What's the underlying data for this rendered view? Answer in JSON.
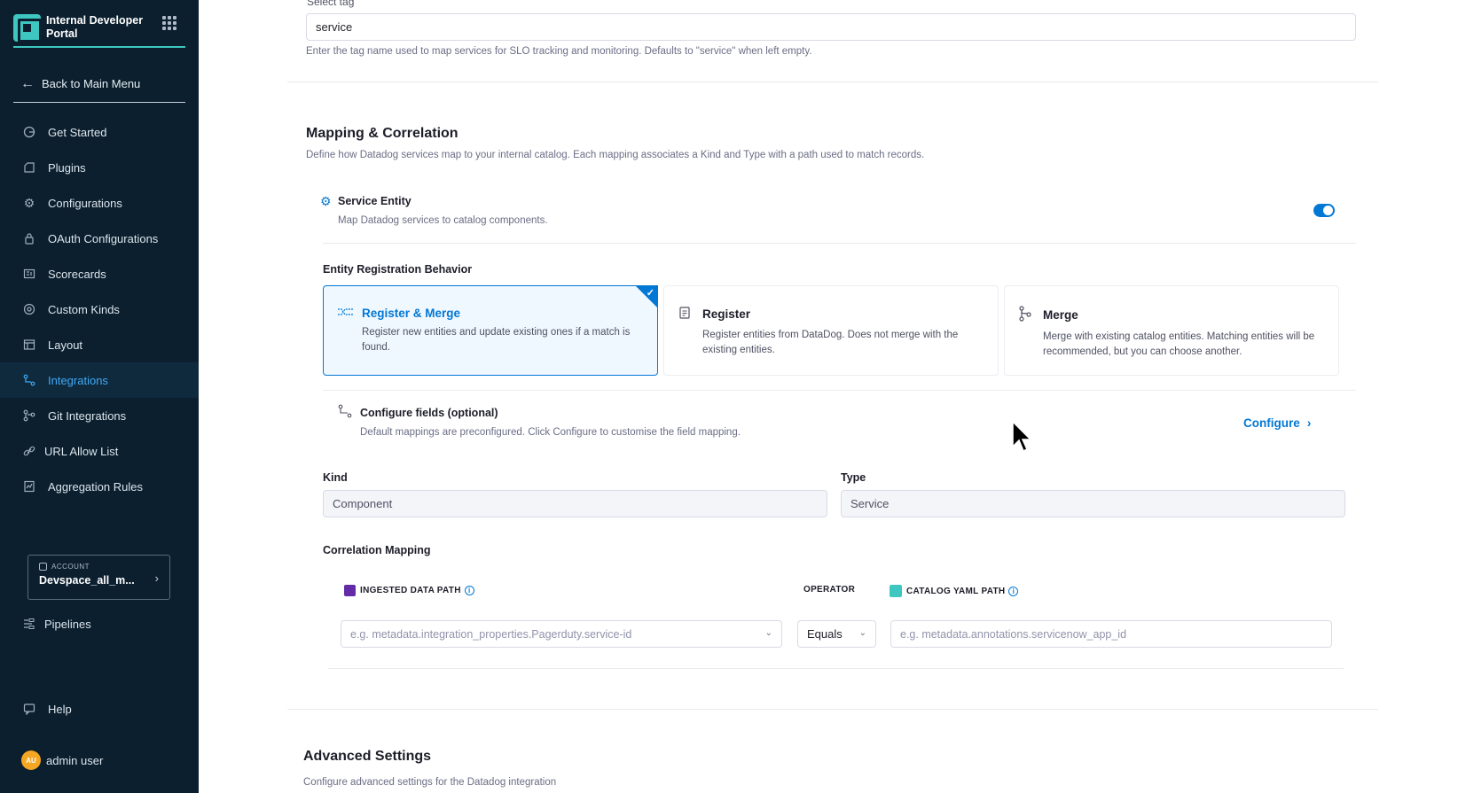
{
  "sidebar": {
    "brand_title": "Internal Developer Portal",
    "back_label": "Back to Main Menu",
    "items": [
      {
        "label": "Get Started",
        "icon": "play-icon"
      },
      {
        "label": "Plugins",
        "icon": "plug-icon"
      },
      {
        "label": "Configurations",
        "icon": "gear-icon"
      },
      {
        "label": "OAuth Configurations",
        "icon": "lock-icon"
      },
      {
        "label": "Scorecards",
        "icon": "scorecard-icon"
      },
      {
        "label": "Custom Kinds",
        "icon": "settings-icon"
      },
      {
        "label": "Layout",
        "icon": "layout-icon"
      },
      {
        "label": "Integrations",
        "icon": "integration-icon",
        "active": true
      },
      {
        "label": "Git Integrations",
        "icon": "git-icon"
      },
      {
        "label": "URL Allow List",
        "icon": "link-icon"
      },
      {
        "label": "Aggregation Rules",
        "icon": "rules-icon"
      }
    ],
    "account": {
      "label": "ACCOUNT",
      "value": "Devspace_all_m..."
    },
    "pipelines_label": "Pipelines",
    "help_label": "Help",
    "user": {
      "initials": "AU",
      "name": "admin user"
    }
  },
  "select_tag": {
    "label": "Select tag",
    "value": "service",
    "help": "Enter the tag name used to map services for SLO tracking and monitoring. Defaults to \"service\" when left empty."
  },
  "mapping": {
    "title": "Mapping & Correlation",
    "description": "Define how Datadog services map to your internal catalog. Each mapping associates a Kind and Type with a path used to match records.",
    "service_entity": {
      "title": "Service Entity",
      "description": "Map Datadog services to catalog components.",
      "enabled": true
    },
    "registration": {
      "title": "Entity Registration Behavior",
      "options": [
        {
          "title": "Register & Merge",
          "description": "Register new entities and update existing ones if a match is found.",
          "selected": true
        },
        {
          "title": "Register",
          "description": "Register entities from DataDog. Does not merge with the existing entities.",
          "selected": false
        },
        {
          "title": "Merge",
          "description": "Merge with existing catalog entities. Matching entities will be recommended, but you can choose another.",
          "selected": false
        }
      ]
    },
    "configure_fields": {
      "title": "Configure fields (optional)",
      "description": "Default mappings are preconfigured. Click Configure to customise the field mapping.",
      "button": "Configure"
    },
    "kind": {
      "label": "Kind",
      "value": "Component"
    },
    "type": {
      "label": "Type",
      "value": "Service"
    },
    "correlation": {
      "title": "Correlation Mapping",
      "col_ingested": "INGESTED DATA PATH",
      "col_operator": "OPERATOR",
      "col_catalog": "CATALOG YAML PATH",
      "ingested_placeholder": "e.g. metadata.integration_properties.Pagerduty.service-id",
      "operator_value": "Equals",
      "catalog_placeholder": "e.g. metadata.annotations.servicenow_app_id"
    }
  },
  "advanced": {
    "title": "Advanced Settings",
    "description": "Configure advanced settings for the Datadog integration"
  },
  "colors": {
    "sidebar_bg": "#0b1f2e",
    "accent": "#0278d5",
    "brand": "#3dc7c0"
  }
}
